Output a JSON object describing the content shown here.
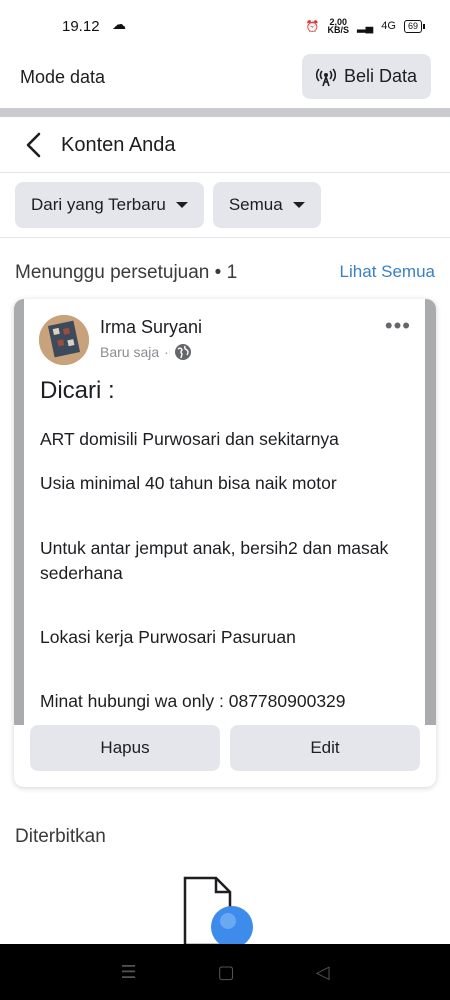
{
  "status_bar": {
    "time": "19.12",
    "speed_value": "2,00",
    "speed_unit": "KB/S",
    "network": "4G",
    "battery": "69"
  },
  "mode_bar": {
    "label": "Mode data",
    "buy_button": "Beli Data"
  },
  "header": {
    "title": "Konten Anda"
  },
  "filters": {
    "sort": "Dari yang Terbaru",
    "scope": "Semua"
  },
  "pending": {
    "title": "Menunggu persetujuan • 1",
    "see_all": "Lihat Semua"
  },
  "post": {
    "author": "Irma Suryani",
    "time": "Baru saja",
    "more": "•••",
    "heading": "Dicari :",
    "lines": [
      "ART domisili Purwosari dan sekitarnya",
      "Usia minimal 40 tahun bisa naik motor",
      "Untuk antar jemput anak, bersih2 dan masak sederhana",
      "Lokasi kerja Purwosari Pasuruan",
      "Minat hubungi wa only : 087780900329"
    ],
    "delete_button": "Hapus",
    "edit_button": "Edit"
  },
  "published": {
    "title": "Diterbitkan"
  },
  "colors": {
    "link": "#3b7fc4",
    "chip_bg": "#e4e6eb",
    "accent_blue": "#3d8bea"
  },
  "icons": {
    "back": "chevron-left-icon",
    "antenna": "antenna-icon",
    "globe": "globe-icon",
    "document": "document-search-icon"
  }
}
